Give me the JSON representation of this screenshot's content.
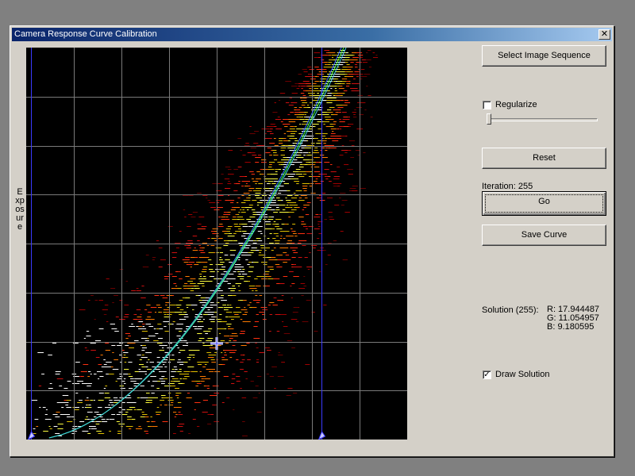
{
  "window": {
    "title": "Camera Response Curve Calibration",
    "close_glyph": "✕"
  },
  "plot": {
    "ylabel": "Exposure",
    "grid_cols": 8,
    "grid_rows": 8,
    "left_marker_pct": 0.012,
    "right_marker_pct": 0.775,
    "cursor_x_pct": 0.5,
    "cursor_y_pct": 0.755,
    "colors": {
      "background": "#000000",
      "grid": "#7a7a7a",
      "marker": "#3a3aff",
      "curve": "#40d0e0"
    }
  },
  "controls": {
    "select_button": "Select Image Sequence",
    "regularize_label": "Regularize",
    "regularize_checked": false,
    "slider_value": 0,
    "reset_button": "Reset",
    "iteration_text": "Iteration: 255",
    "go_button": "Go",
    "save_button": "Save Curve",
    "solution_label": "Solution (255):",
    "solution_r": "R: 17.944487",
    "solution_g": "G: 11.054957",
    "solution_b": "B: 9.180595",
    "draw_solution_label": "Draw Solution",
    "draw_solution_checked": true
  }
}
